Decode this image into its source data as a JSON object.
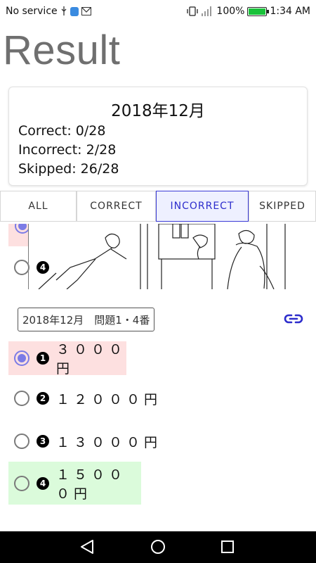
{
  "status_bar": {
    "carrier": "No service",
    "battery_percent": "100%",
    "time": "1:34 AM"
  },
  "page": {
    "title": "Result"
  },
  "summary": {
    "title": "2018年12月",
    "correct": "Correct: 0/28",
    "incorrect": "Incorrect: 2/28",
    "skipped": "Skipped: 26/28"
  },
  "tabs": [
    {
      "label": "ALL",
      "active": false
    },
    {
      "label": "CORRECT",
      "active": false
    },
    {
      "label": "INCORRECT",
      "active": true
    },
    {
      "label": "SKIPPED",
      "active": false
    }
  ],
  "question": {
    "tag": "2018年12月　問題1・4番",
    "options": [
      {
        "number": "1",
        "text": "３０００円",
        "selected": true,
        "status": "incorrect"
      },
      {
        "number": "2",
        "text": "１２０００円",
        "selected": false,
        "status": "none"
      },
      {
        "number": "3",
        "text": "１３０００円",
        "selected": false,
        "status": "none"
      },
      {
        "number": "4",
        "text": "１５０００円",
        "selected": false,
        "status": "correct"
      }
    ],
    "partial_previous_option_number": "4"
  },
  "colors": {
    "accent": "#3b3bd6",
    "incorrect_bg": "#fde0e0",
    "correct_bg": "#dbfbdb",
    "radio_selected": "#7b7be6"
  }
}
